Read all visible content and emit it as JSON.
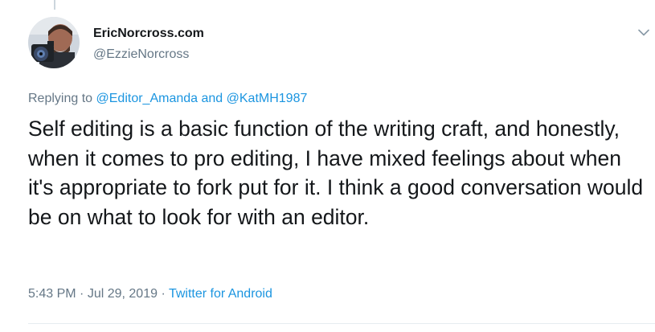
{
  "tweet": {
    "display_name": "EricNorcross.com",
    "handle": "@EzzieNorcross",
    "reply_prefix": "Replying to ",
    "reply_to_1": "@Editor_Amanda",
    "reply_and": " and ",
    "reply_to_2": "@KatMH1987",
    "text": "Self editing is a basic function of the writing craft, and honestly, when it comes to pro editing, I have mixed feelings about when it's appropriate to fork put for it. I think a good conversation would be on what to look for with an editor.",
    "time": "5:43 PM",
    "separator_1": " · ",
    "date": "Jul 29, 2019",
    "separator_2": " · ",
    "source": "Twitter for Android"
  },
  "icons": {
    "more": "chevron-down-icon",
    "avatar": "profile-photo"
  },
  "colors": {
    "link": "#1b95e0",
    "muted": "#657786",
    "text": "#14171a"
  }
}
